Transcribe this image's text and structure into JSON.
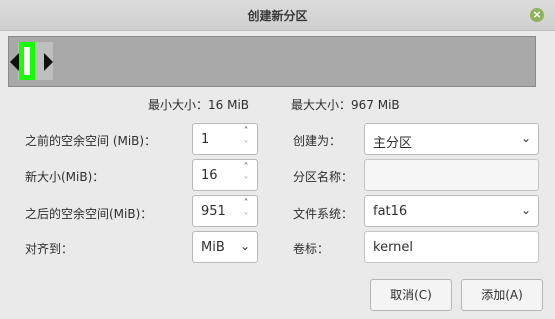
{
  "window": {
    "title": "创建新分区",
    "close_symbol": "×"
  },
  "sizes": {
    "min_label": "最小大小：16 MiB",
    "max_label": "最大大小：967 MiB"
  },
  "fields": {
    "free_before": {
      "label": "之前的空余空间 (MiB)：",
      "value": "1"
    },
    "new_size": {
      "label": "新大小(MiB)：",
      "value": "16"
    },
    "free_after": {
      "label": "之后的空余空间(MiB)：",
      "value": "951"
    },
    "align_to": {
      "label": "对齐到：",
      "value": "MiB"
    },
    "create_as": {
      "label": "创建为：",
      "value": "主分区"
    },
    "partition_name": {
      "label": "分区名称：",
      "value": ""
    },
    "filesystem": {
      "label": "文件系统：",
      "value": "fat16"
    },
    "label": {
      "label": "卷标：",
      "value": "kernel"
    }
  },
  "buttons": {
    "cancel": "取消(C)",
    "add": "添加(A)"
  },
  "colors": {
    "partition_outline": "#18ff00",
    "preview_bg": "#a8a8a8"
  }
}
